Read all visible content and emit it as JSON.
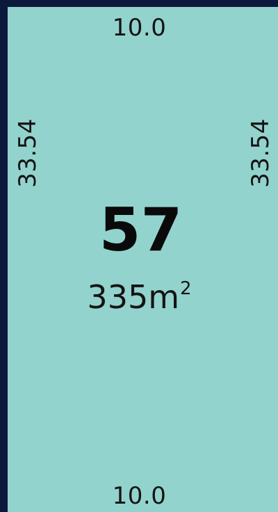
{
  "lot": {
    "number": "57",
    "area_value": "335m",
    "area_superscript": "2",
    "frontage_top": "10.0",
    "frontage_bottom": "10.0",
    "depth_left": "33.54",
    "depth_right": "33.54"
  },
  "colors": {
    "background": "#0b1a3c",
    "lot_fill": "#93d3cd",
    "text": "#141414"
  }
}
